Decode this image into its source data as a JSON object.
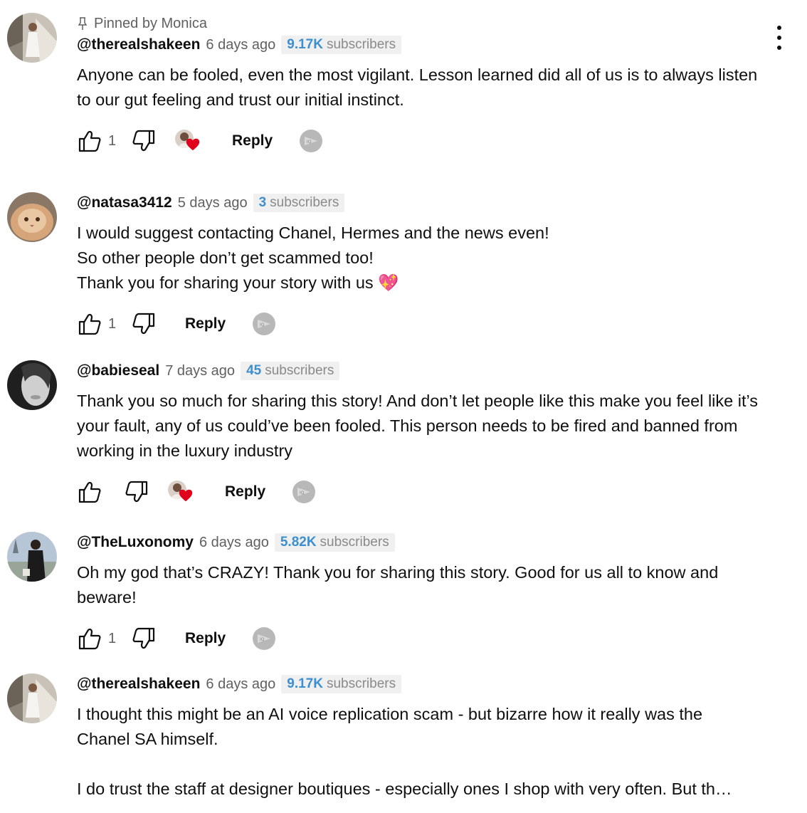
{
  "comments": [
    {
      "pinned_label": "Pinned by Monica",
      "author": "@therealshakeen",
      "time": "6 days ago",
      "subs_count": "9.17K",
      "subs_label": "subscribers",
      "text": "Anyone can be fooled, even the most vigilant. Lesson learned did all of us is to always listen to our gut feeling and trust our initial instinct.",
      "likes": "1",
      "creator_heart": true,
      "reply_label": "Reply",
      "avatar": "woman-stairs-avatar"
    },
    {
      "author": "@natasa3412",
      "time": "5 days ago",
      "subs_count": "3",
      "subs_label": "subscribers",
      "text": "I would suggest contacting Chanel, Hermes and the news even!\nSo other people don’t get scammed too!\nThank you for sharing your story with us 💖",
      "likes": "1",
      "creator_heart": false,
      "reply_label": "Reply",
      "avatar": "persian-cat-avatar"
    },
    {
      "author": "@babieseal",
      "time": "7 days ago",
      "subs_count": "45",
      "subs_label": "subscribers",
      "text": "Thank you so much for sharing this story! And don’t let people like this make you feel like it’s your fault, any of us could’ve been fooled. This person needs to be fired and banned from working in the luxury industry",
      "likes": "",
      "creator_heart": true,
      "reply_label": "Reply",
      "avatar": "statue-face-avatar"
    },
    {
      "author": "@TheLuxonomy",
      "time": "6 days ago",
      "subs_count": "5.82K",
      "subs_label": "subscribers",
      "text": "Oh my god that’s CRAZY! Thank you for sharing this story. Good for us all to know and beware!",
      "likes": "1",
      "creator_heart": false,
      "reply_label": "Reply",
      "avatar": "person-paris-avatar"
    },
    {
      "author": "@therealshakeen",
      "time": "6 days ago",
      "subs_count": "9.17K",
      "subs_label": "subscribers",
      "text": "I thought this might be an AI voice replication scam - but bizarre how it really was the Chanel SA himself.\n\nI do trust the staff at designer boutiques - especially ones I shop with very often. But th…",
      "avatar": "woman-stairs-avatar"
    }
  ],
  "colors": {
    "subs_number": "#3d8fcf",
    "heart": "#e0001b",
    "secondary_text": "#606060"
  }
}
